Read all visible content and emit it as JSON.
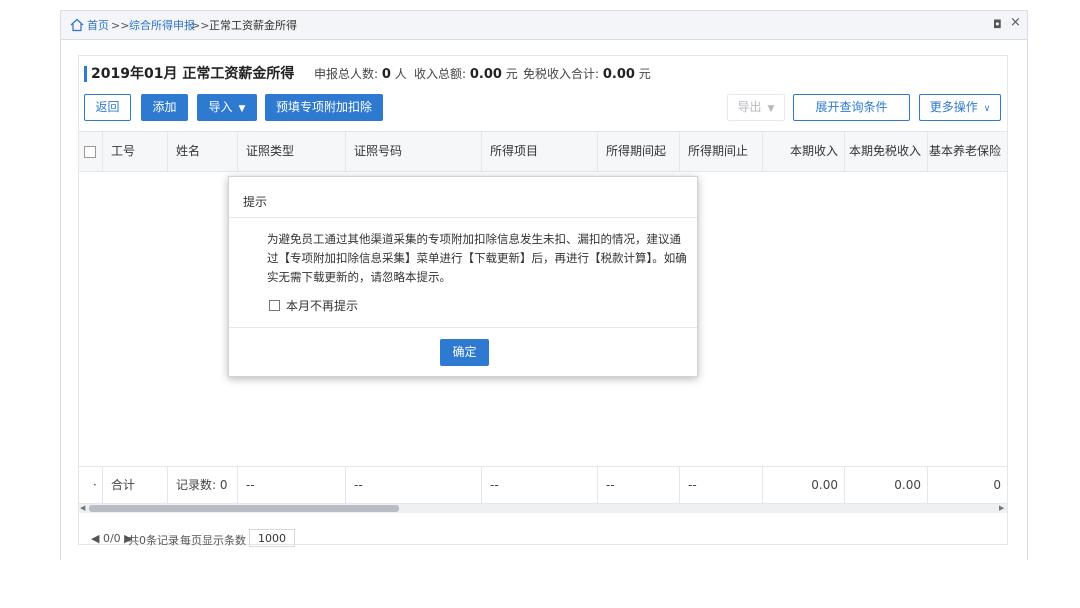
{
  "breadcrumb": {
    "home": "首页",
    "sep": ">>",
    "level2": "综合所得申报",
    "current": "正常工资薪金所得"
  },
  "window_controls": {
    "restore": "◘",
    "close": "×"
  },
  "header": {
    "title": "2019年01月 正常工资薪金所得",
    "stats": [
      {
        "label": "申报总人数:",
        "value": "0",
        "unit": "人"
      },
      {
        "label": "收入总额:",
        "value": "0.00",
        "unit": "元"
      },
      {
        "label": "免税收入合计:",
        "value": "0.00",
        "unit": "元"
      }
    ]
  },
  "toolbar": {
    "back": "返回",
    "add": "添加",
    "import": "导入",
    "prefill": "预填专项附加扣除",
    "export": "导出",
    "expand_query": "展开查询条件",
    "more": "更多操作"
  },
  "table": {
    "columns": [
      "工号",
      "姓名",
      "证照类型",
      "证照号码",
      "所得项目",
      "所得期间起",
      "所得期间止",
      "本期收入",
      "本期免税收入",
      "基本养老保险"
    ],
    "summary": [
      "合计",
      "记录数: 0",
      "--",
      "--",
      "--",
      "--",
      "--",
      "0.00",
      "0.00",
      "0"
    ]
  },
  "pager": {
    "nav": "◀ 0/0 ▶",
    "total": "共0条记录",
    "per_page_label": "每页显示条数",
    "per_page": "1000"
  },
  "dialog": {
    "title": "提示",
    "message": "为避免员工通过其他渠道采集的专项附加扣除信息发生未扣、漏扣的情况，建议通过【专项附加扣除信息采集】菜单进行【下载更新】后，再进行【税款计算】。如确实无需下载更新的，请忽略本提示。",
    "checkbox": "本月不再提示",
    "ok": "确定"
  },
  "colors": {
    "accent": "#2e7ad1",
    "link": "#2f73c8"
  }
}
